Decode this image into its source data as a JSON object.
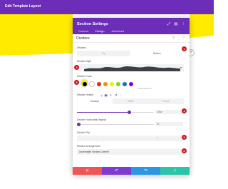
{
  "app": {
    "title": "Edit Template Layout"
  },
  "modal": {
    "title": "Section Settings",
    "tabs": [
      {
        "label": "Content",
        "active": false
      },
      {
        "label": "Design",
        "active": true
      },
      {
        "label": "Advanced",
        "active": false
      }
    ],
    "section": {
      "title": "Dividers"
    },
    "dividers": {
      "label": "Dividers",
      "options": [
        "Top",
        "Bottom"
      ],
      "selected": "Bottom"
    },
    "divider_style": {
      "label": "Divider Style"
    },
    "divider_color": {
      "label": "Divider Color",
      "selected_color": "#ffeb00",
      "swatches": [
        "#000000",
        "#ffffff",
        "#e02b20",
        "#e09900",
        "#edf000",
        "#7cda24",
        "#0c71c3",
        "#8300e9"
      ],
      "saved_label": "Saved",
      "recent_label": "Recent"
    },
    "divider_height": {
      "label": "Divider Height",
      "devices": [
        "Desktop",
        "Tablet",
        "Phone"
      ],
      "active_device": "Desktop",
      "value": "20vw",
      "slider_level": 0.68
    },
    "divider_repeat": {
      "label": "Divider Horizontal Repeat",
      "value": "1x",
      "slider_level": 0.02
    },
    "divider_flip": {
      "label": "Divider Flip"
    },
    "divider_arrangement": {
      "label": "Divider Arrangement",
      "value": "Underneath Section Content"
    },
    "markers": [
      "1",
      "2",
      "3",
      "4",
      "5",
      "6"
    ]
  },
  "colors": {
    "brand": "#6c2eb9",
    "cancel": "#ef5555",
    "undo": "#7e3bd0",
    "redo": "#2b96e1",
    "save": "#29c4a9",
    "marker": "#c5191f",
    "canvas_accent": "#ffeb00"
  },
  "icons": {
    "cancel": "close-icon",
    "undo": "undo-icon",
    "redo": "redo-icon",
    "save": "check-icon"
  }
}
